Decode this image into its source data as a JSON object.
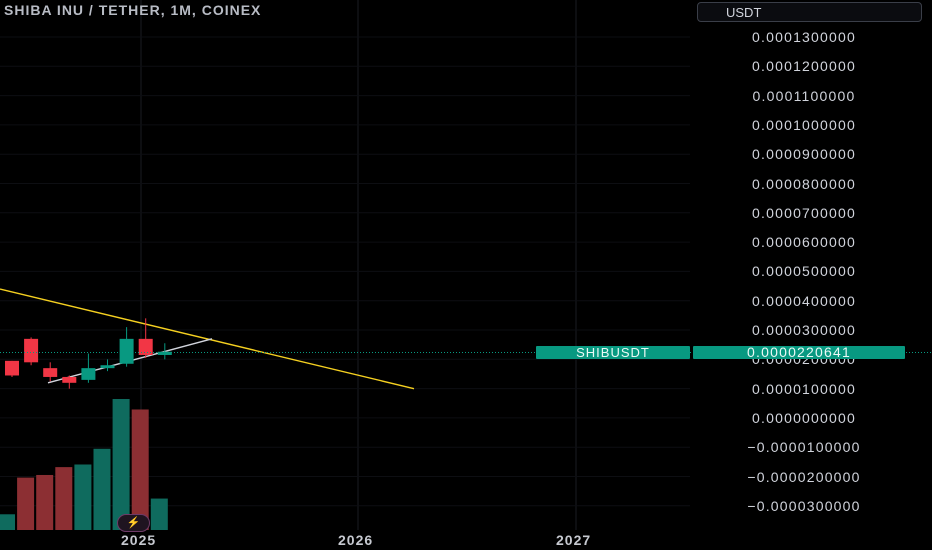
{
  "header": {
    "title": "SHIBA INU / TETHER, 1M, COINEX",
    "currency_label": "USDT"
  },
  "price_axis": {
    "labels": [
      "0.0001300000",
      "0.0001200000",
      "0.0001100000",
      "0.0001000000",
      "0.0000900000",
      "0.0000800000",
      "0.0000700000",
      "0.0000600000",
      "0.0000500000",
      "0.0000400000",
      "0.0000300000",
      "0.0000200000",
      "0.0000100000",
      "0.0000000000",
      "−0.0000100000",
      "−0.0000200000",
      "−0.0000300000"
    ]
  },
  "time_axis": {
    "labels": [
      "2025",
      "2026",
      "2027"
    ]
  },
  "last_price": {
    "symbol": "SHIBUSDT",
    "value": "0.0000220641"
  },
  "flash_icon": "lightning-icon",
  "colors": {
    "up": "#089981",
    "down": "#f23645",
    "trendline": "#f5d020",
    "support": "#d1d4dc",
    "grid": "#1a1c22"
  },
  "chart_data": {
    "type": "candlestick",
    "title": "SHIBA INU / TETHER, 1M, COINEX",
    "y_unit": "USDT",
    "ylim": [
      -3.5e-05,
      0.000135
    ],
    "x_labels": [
      "2025",
      "2026",
      "2027"
    ],
    "candles": [
      {
        "o": 1.9e-05,
        "h": 1.8e-05,
        "l": 1.35e-05,
        "c": 1.4e-05,
        "dir": "down"
      },
      {
        "o": 2.65e-05,
        "h": 2.7e-05,
        "l": 1.75e-05,
        "c": 1.85e-05,
        "dir": "down"
      },
      {
        "o": 1.65e-05,
        "h": 1.85e-05,
        "l": 1.2e-05,
        "c": 1.35e-05,
        "dir": "down"
      },
      {
        "o": 1.35e-05,
        "h": 1.4e-05,
        "l": 9.5e-06,
        "c": 1.15e-05,
        "dir": "down"
      },
      {
        "o": 1.25e-05,
        "h": 2.15e-05,
        "l": 1.15e-05,
        "c": 1.65e-05,
        "dir": "up"
      },
      {
        "o": 1.65e-05,
        "h": 1.95e-05,
        "l": 1.55e-05,
        "c": 1.75e-05,
        "dir": "up"
      },
      {
        "o": 1.8e-05,
        "h": 3.05e-05,
        "l": 1.7e-05,
        "c": 2.65e-05,
        "dir": "up"
      },
      {
        "o": 2.65e-05,
        "h": 3.35e-05,
        "l": 2e-05,
        "c": 2.1e-05,
        "dir": "down"
      },
      {
        "o": 2.1e-05,
        "h": 2.5e-05,
        "l": 1.95e-05,
        "c": 2.21e-05,
        "dir": "up"
      }
    ],
    "volume": [
      {
        "v": 0.12,
        "dir": "up"
      },
      {
        "v": 0.4,
        "dir": "down"
      },
      {
        "v": 0.42,
        "dir": "down"
      },
      {
        "v": 0.48,
        "dir": "down"
      },
      {
        "v": 0.5,
        "dir": "up"
      },
      {
        "v": 0.62,
        "dir": "up"
      },
      {
        "v": 1.0,
        "dir": "up"
      },
      {
        "v": 0.92,
        "dir": "down"
      },
      {
        "v": 0.24,
        "dir": "up"
      }
    ],
    "lines": [
      {
        "name": "descending-trendline",
        "from": 4.35e-05,
        "to": 9.5e-06
      },
      {
        "name": "ascending-support",
        "from": 1.15e-05,
        "to": 2.65e-05
      }
    ]
  }
}
